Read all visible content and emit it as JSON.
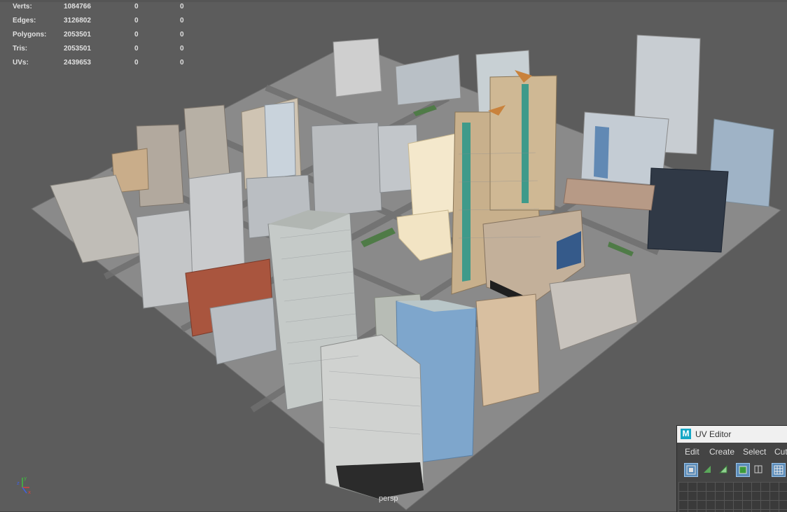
{
  "viewport": {
    "camera_label": "persp",
    "heads_up": {
      "rows": [
        {
          "label": "Verts:",
          "values": [
            "1084766",
            "0",
            "0"
          ]
        },
        {
          "label": "Edges:",
          "values": [
            "3126802",
            "0",
            "0"
          ]
        },
        {
          "label": "Polygons:",
          "values": [
            "2053501",
            "0",
            "0"
          ]
        },
        {
          "label": "Tris:",
          "values": [
            "2053501",
            "0",
            "0"
          ]
        },
        {
          "label": "UVs:",
          "values": [
            "2439653",
            "0",
            "0"
          ]
        }
      ]
    },
    "axis": {
      "y": "y",
      "x": "x",
      "z": "z"
    }
  },
  "uv_editor": {
    "logo": "M",
    "title": "UV Editor",
    "menu": [
      "Edit",
      "Create",
      "Select",
      "Cut"
    ],
    "toolbar_icons": [
      "uv-shell-icon",
      "uv-tri-icon",
      "uv-tri-filled-icon",
      "uv-box-icon",
      "uv-box-outline-icon",
      "uv-grid-icon"
    ]
  },
  "colors": {
    "viewport_bg": "#5c5c5c",
    "accent": "#14a7c5",
    "selected_building": "#f4e8cc"
  }
}
